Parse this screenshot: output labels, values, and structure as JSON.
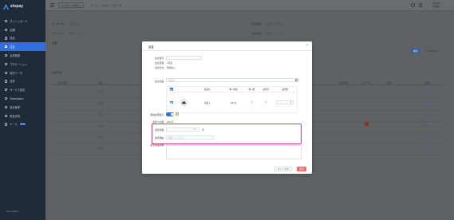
{
  "sidebar": {
    "logo_text": "elepay",
    "items": [
      {
        "label": "ダッシュボード"
      },
      {
        "label": "店舗"
      },
      {
        "label": "商品"
      },
      {
        "label": "注文"
      },
      {
        "label": "会員管理"
      },
      {
        "label": "プロモーション"
      },
      {
        "label": "統計データ"
      },
      {
        "label": "決済"
      },
      {
        "label": "サービス設定"
      },
      {
        "label": "Marketplace"
      },
      {
        "label": "設定管理"
      },
      {
        "label": "取扱説明"
      },
      {
        "label": "ケース",
        "tag": "BETA"
      }
    ],
    "active_index": 3,
    "footer": "Go to elepay ↗"
  },
  "header": {
    "button_label": "サポート案内",
    "breadcrumbs": [
      "ホーム",
      "/",
      "OneOS",
      "/",
      "注文一覧"
    ],
    "user_name": "ELEPAY",
    "user_sub": "管理者"
  },
  "page": {
    "filter_order_no_label": "オーダーNo：",
    "filter_order_no_ph": "注文番号",
    "filter_status_label": "ステータス：",
    "filter_status_ph": "選択してください",
    "filter_period_label": "注文期間：",
    "filter_period_ph": "開始日 〜 終了日",
    "filter_payment_label": "決済方法：",
    "filter_payment_ph": "選択してください",
    "search_label": "検索",
    "export_label": "CSV Export",
    "table_label": "注文管理",
    "columns": [
      "注文番号",
      "店舗",
      "",
      "",
      "",
      "",
      "",
      "決済方法",
      "ステータス",
      "返金",
      "操作"
    ],
    "rows": [
      {
        "store": "1号店",
        "action": "詳細"
      },
      {
        "store": "1号店",
        "action": "詳細"
      },
      {
        "store": "1号店",
        "action": "詳細"
      },
      {
        "store": "1号店",
        "action": "詳細"
      },
      {
        "store": "1号店",
        "action": "詳細"
      },
      {
        "store": "1号店",
        "action": "詳細"
      }
    ]
  },
  "modal": {
    "title": "返金",
    "order_no_label": "注文番号：",
    "order_no_value": "",
    "store_label": "注文店舗：",
    "store_value": "1号店",
    "payment_label": "決済方法：",
    "payment_value": "現金払い",
    "product_label": "注文商品：",
    "product_search_ph": "商品名",
    "table": {
      "headers": [
        "",
        "",
        "商品名",
        "購入価格",
        "購入数",
        "返金済",
        "返金数"
      ],
      "row": {
        "name": "商品 1",
        "price": "100 円",
        "qty": "1",
        "refunded": "0",
        "refund_qty": "1"
      }
    },
    "inventory_label": "関連在庫復元：",
    "refund_total_label": "返金小計額：",
    "refund_total_value": "100 円",
    "refund_amount_label": "返金金額：",
    "refund_amount_value": "100",
    "refund_amount_unit": "円",
    "refund_reason_label": "返金理由：",
    "refund_reason_ph": "選択してください",
    "memo_label": "返金理由詳細：",
    "cancel_label": "キャンセル",
    "ok_label": "返金",
    "accent_color": "#2f6fe0",
    "danger_color": "#f56c6c",
    "highlight_color": "#e0338a"
  }
}
